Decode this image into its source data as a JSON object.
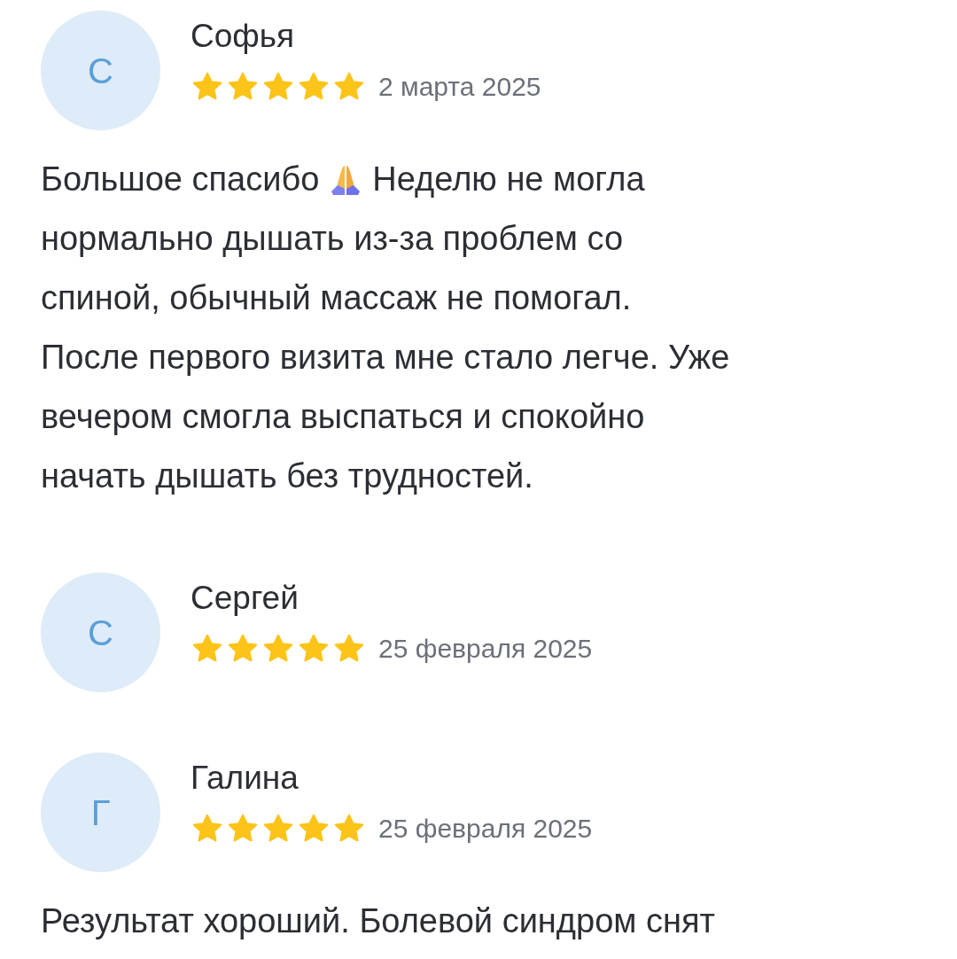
{
  "reviews": [
    {
      "initial": "С",
      "name": "Софья",
      "stars": 5,
      "date": "2 марта 2025",
      "lines": [
        [
          {
            "kind": "text",
            "text": "Большое спасибо"
          },
          {
            "kind": "praying-hands"
          },
          {
            "kind": "text",
            "text": "Неделю не могла"
          }
        ],
        [
          {
            "kind": "text",
            "text": "нормально дышать из-за проблем со"
          }
        ],
        [
          {
            "kind": "text",
            "text": "спиной, обычный массаж не помогал."
          }
        ],
        [
          {
            "kind": "text",
            "text": "После первого визита мне стало легче. Уже"
          }
        ],
        [
          {
            "kind": "text",
            "text": "вечером смогла выспаться и спокойно"
          }
        ],
        [
          {
            "kind": "text",
            "text": "начать дышать без трудностей."
          }
        ]
      ]
    },
    {
      "initial": "С",
      "name": "Сергей",
      "stars": 5,
      "date": "25 февраля 2025"
    },
    {
      "initial": "Г",
      "name": "Галина",
      "stars": 5,
      "date": "25 февраля 2025",
      "lines": [
        [
          {
            "kind": "text",
            "text": "Результат хороший. Болевой синдром снят"
          }
        ]
      ]
    }
  ]
}
